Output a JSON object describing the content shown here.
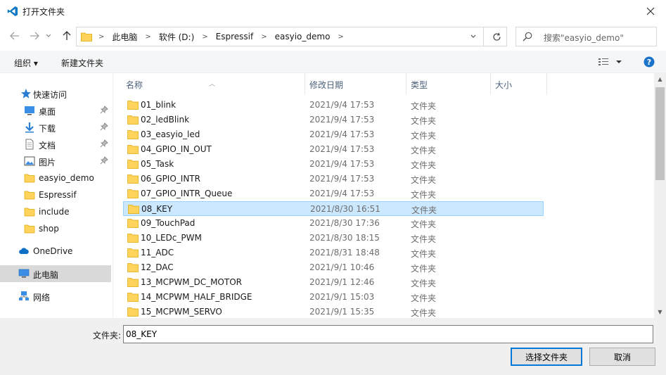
{
  "window": {
    "title": "打开文件夹"
  },
  "address": {
    "crumbs": [
      "此电脑",
      "软件 (D:)",
      "Espressif",
      "easyio_demo"
    ]
  },
  "search": {
    "placeholder": "搜索\"easyio_demo\""
  },
  "toolbar": {
    "organize": "组织 ▾",
    "new_folder": "新建文件夹"
  },
  "sidebar": {
    "items": [
      {
        "label": "快速访问",
        "icon": "star-icon"
      },
      {
        "label": "桌面",
        "icon": "desktop-icon",
        "pinned": true
      },
      {
        "label": "下载",
        "icon": "download-icon",
        "pinned": true
      },
      {
        "label": "文档",
        "icon": "document-icon",
        "pinned": true
      },
      {
        "label": "图片",
        "icon": "picture-icon",
        "pinned": true
      },
      {
        "label": "easyio_demo",
        "icon": "folder-icon"
      },
      {
        "label": "Espressif",
        "icon": "folder-icon"
      },
      {
        "label": "include",
        "icon": "folder-icon"
      },
      {
        "label": "shop",
        "icon": "folder-icon"
      },
      {
        "label": "OneDrive",
        "icon": "cloud-icon"
      },
      {
        "label": "此电脑",
        "icon": "computer-icon",
        "selected": true
      },
      {
        "label": "网络",
        "icon": "network-icon"
      }
    ]
  },
  "columns": {
    "name": "名称",
    "modified": "修改日期",
    "type": "类型",
    "size": "大小"
  },
  "files": [
    {
      "name": "01_blink",
      "modified": "2021/9/4 17:53",
      "type": "文件夹"
    },
    {
      "name": "02_ledBlink",
      "modified": "2021/9/4 17:53",
      "type": "文件夹"
    },
    {
      "name": "03_easyio_led",
      "modified": "2021/9/4 17:53",
      "type": "文件夹"
    },
    {
      "name": "04_GPIO_IN_OUT",
      "modified": "2021/9/4 17:53",
      "type": "文件夹"
    },
    {
      "name": "05_Task",
      "modified": "2021/9/4 17:53",
      "type": "文件夹"
    },
    {
      "name": "06_GPIO_INTR",
      "modified": "2021/9/4 17:53",
      "type": "文件夹"
    },
    {
      "name": "07_GPIO_INTR_Queue",
      "modified": "2021/9/4 17:53",
      "type": "文件夹"
    },
    {
      "name": "08_KEY",
      "modified": "2021/8/30 16:51",
      "type": "文件夹",
      "selected": true
    },
    {
      "name": "09_TouchPad",
      "modified": "2021/8/30 17:36",
      "type": "文件夹"
    },
    {
      "name": "10_LEDc_PWM",
      "modified": "2021/8/30 18:15",
      "type": "文件夹"
    },
    {
      "name": "11_ADC",
      "modified": "2021/8/31 18:48",
      "type": "文件夹"
    },
    {
      "name": "12_DAC",
      "modified": "2021/9/1 10:46",
      "type": "文件夹"
    },
    {
      "name": "13_MCPWM_DC_MOTOR",
      "modified": "2021/9/1 12:46",
      "type": "文件夹"
    },
    {
      "name": "14_MCPWM_HALF_BRIDGE",
      "modified": "2021/9/1 15:03",
      "type": "文件夹"
    },
    {
      "name": "15_MCPWM_SERVO",
      "modified": "2021/9/1 15:35",
      "type": "文件夹"
    }
  ],
  "footer": {
    "folder_label": "文件夹:",
    "folder_value": "08_KEY",
    "select_button": "选择文件夹",
    "cancel_button": "取消"
  },
  "colors": {
    "accent": "#0078d7",
    "folder": "#ffd35c",
    "selection": "#cce8ff"
  }
}
